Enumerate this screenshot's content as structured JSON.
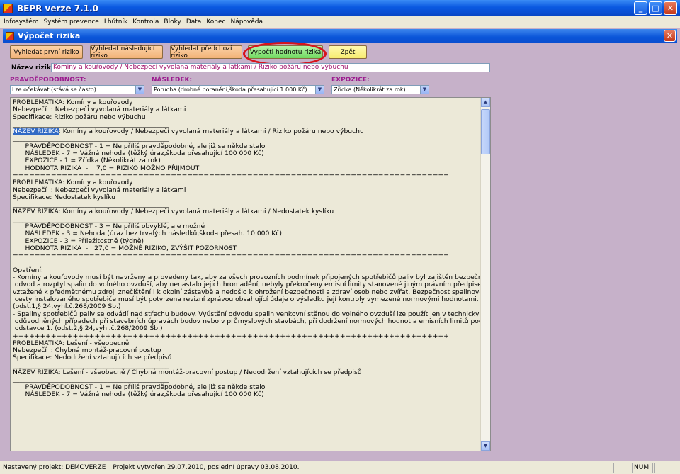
{
  "app": {
    "title": "BEPR verze 7.1.0"
  },
  "menu": [
    "Infosystém",
    "Systém prevence",
    "Lhůtník",
    "Kontrola",
    "Bloky",
    "Data",
    "Konec",
    "Nápověda"
  ],
  "window": {
    "title": "Výpočet rizika",
    "close_label": "✕"
  },
  "toolbar": {
    "find_first": "Vyhledat první riziko",
    "find_next": "Vyhledat následující riziko",
    "find_prev": "Vyhledat předchozí riziko",
    "compute": "Vypočti hodnotu rizika",
    "back": "Zpět"
  },
  "name": {
    "label": "Název rizika",
    "value": "Komíny a kouřovody / Nebezpečí vyvolaná materiály a látkami / Riziko požáru nebo výbuchu"
  },
  "selectors": {
    "probability": {
      "label": "PRAVDĚPODOBNOST:",
      "value": "Lze očekávat (stává se často)"
    },
    "consequence": {
      "label": "NÁSLEDEK:",
      "value": "Porucha (drobné poranění,škoda přesahující 1 000 Kč)"
    },
    "exposure": {
      "label": "EXPOZICE:",
      "value": "Zřídka (Několikrát za rok)"
    }
  },
  "text": {
    "before_hl": "PROBLEMATIKA: Komíny a kouřovody\nNebezpečí  : Nebezpečí vyvolaná materiály a látkami\nSpecifikace: Riziko požáru nebo výbuchu\n________________________________________________\n",
    "hl": "NÁZEV RIZIKA",
    "after_hl": ": Komíny a kouřovody / Nebezpečí vyvolaná materiály a látkami / Riziko požáru nebo výbuchu\n________________________________________________\n      PRAVDĚPODOBNOST - 1 = Ne příliš pravděpodobné, ale již se někde stalo\n      NÁSLEDEK - 7 = Vážná nehoda (těžký úraz,škoda přesahující 100 000 Kč)\n      EXPOZICE - 1 = Zřídka (Několikrát za rok)\n      HODNOTA RIZIKA  -    7,0 = RIZIKO MOŽNO PŘIJMOUT\n================================================================================\nPROBLEMATIKA: Komíny a kouřovody\nNebezpečí  : Nebezpečí vyvolaná materiály a látkami\nSpecifikace: Nedostatek kyslíku\n________________________________________________\nNÁZEV RIZIKA: Komíny a kouřovody / Nebezpečí vyvolaná materiály a látkami / Nedostatek kyslíku\n________________________________________________\n      PRAVDĚPODOBNOST - 3 = Ne příliš obvyklé, ale možné\n      NÁSLEDEK - 3 = Nehoda (úraz bez trvalých následků,škoda přesah. 10 000 Kč)\n      EXPOZICE - 3 = Příležitostně (týdně)\n      HODNOTA RIZIKA  -   27,0 = MOŽNÉ RIZIKO, ZVÝŠIT POZORNOST\n================================================================================\n\nOpatření:\n- Komíny a kouřovody musí být navrženy a provedeny tak, aby za všech provozních podmínek připojených spotřebičů paliv byl zajištěn bezpečný\n odvod a rozptyl spalin do volného ovzduší, aby nenastalo jejich hromadění, nebyly překročeny emisní limity stanovené jiným právním předpisem18)\nvztažené k předmětnému zdroji znečištění i k okolní zástavbě a nedošlo k ohrožení bezpečnosti a zdraví osob nebo zvířat. Bezpečnost spalinové\n cesty instalovaného spotřebiče musí být potvrzena revizní zprávou obsahující údaje o výsledku její kontroly vymezené normovými hodnotami.\n(odst.1,§ 24,vyhl.č.268/2009 Sb.)\n- Spaliny spotřebičů paliv se odvádí nad střechu budovy. Vyústění odvodu spalin venkovní stěnou do volného ovzduší lze použít jen v technicky\n odůvodněných případech při stavebních úpravách budov nebo v průmyslových stavbách, při dodržení normových hodnot a emisních limitů podle\n odstavce 1. (odst.2,§ 24,vyhl.č.268/2009 Sb.)\n++++++++++++++++++++++++++++++++++++++++++++++++++++++++++++++++++++++++++++++++\nPROBLEMATIKA: Lešení - všeobecně\nNebezpečí  : Chybná montáž-pracovní postup\nSpecifikace: Nedodržení vztahujících se předpisů\n________________________________________________\nNÁZEV RIZIKA: Lešení - všeobecně / Chybná montáž-pracovní postup / Nedodržení vztahujících se předpisů\n________________________________________________\n      PRAVDĚPODOBNOST - 1 = Ne příliš pravděpodobné, ale již se někde stalo\n      NÁSLEDEK - 7 = Vážná nehoda (těžký úraz,škoda přesahující 100 000 Kč)"
  },
  "status": {
    "project": "Nastavený projekt: DEMOVERZE",
    "created": "Projekt vytvořen 29.07.2010, poslední úpravy 03.08.2010.",
    "num": "NUM"
  }
}
